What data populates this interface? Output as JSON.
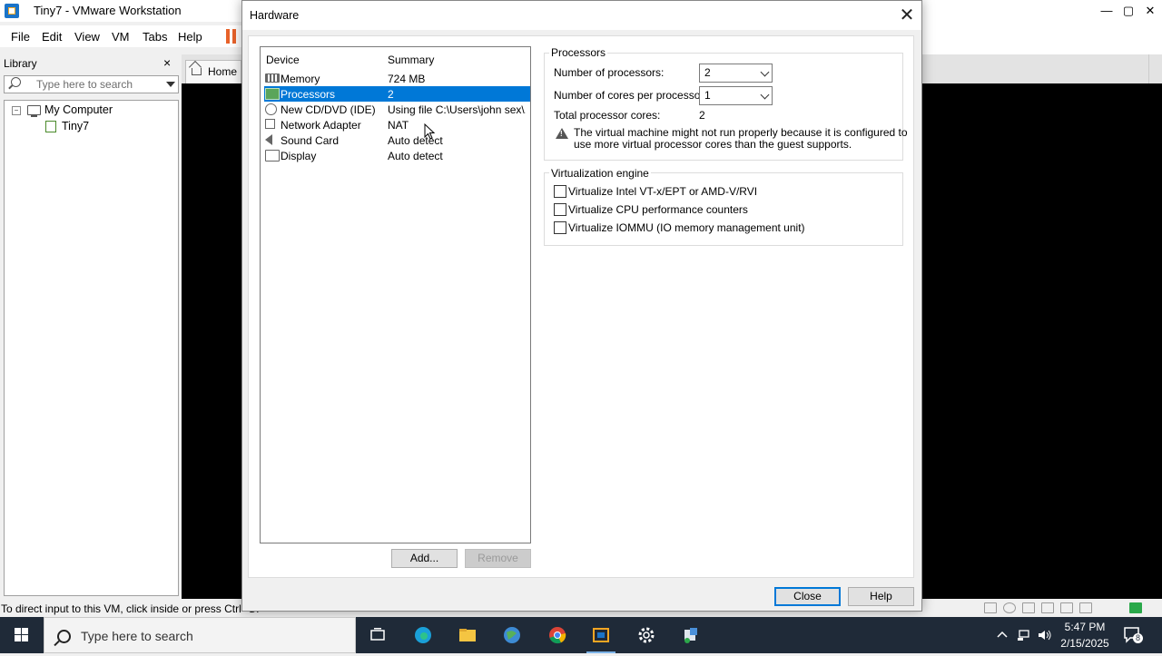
{
  "app": {
    "title": "Tiny7 - VMware Workstation",
    "menu": [
      "File",
      "Edit",
      "View",
      "VM",
      "Tabs",
      "Help"
    ]
  },
  "library": {
    "title": "Library",
    "close": "×",
    "search_placeholder": "Type here to search",
    "tree": {
      "root_label": "My Computer",
      "root_expander": "−",
      "child_label": "Tiny7"
    }
  },
  "tabs": {
    "home": "Home"
  },
  "status": {
    "text": "To direct input to this VM, click inside or press Ctrl+G."
  },
  "dialog": {
    "title": "Hardware",
    "close": "✕",
    "list_headers": {
      "device": "Device",
      "summary": "Summary"
    },
    "devices": [
      {
        "name": "Memory",
        "summary": "724 MB",
        "icon": "memory-icon"
      },
      {
        "name": "Processors",
        "summary": "2",
        "icon": "processor-icon",
        "selected": true
      },
      {
        "name": "New CD/DVD (IDE)",
        "summary": "Using file C:\\Users\\john sex\\...",
        "icon": "cd-dvd-icon"
      },
      {
        "name": "Network Adapter",
        "summary": "NAT",
        "icon": "network-adapter-icon"
      },
      {
        "name": "Sound Card",
        "summary": "Auto detect",
        "icon": "sound-card-icon"
      },
      {
        "name": "Display",
        "summary": "Auto detect",
        "icon": "display-icon"
      }
    ],
    "buttons": {
      "add": "Add...",
      "remove": "Remove",
      "close": "Close",
      "help": "Help"
    },
    "processors": {
      "group_title": "Processors",
      "num_processors_label": "Number of processors:",
      "num_processors_value": "2",
      "cores_label": "Number of cores per processor:",
      "cores_value": "1",
      "total_label": "Total processor cores:",
      "total_value": "2",
      "warning_line1": "The virtual machine might not run properly because it is configured to",
      "warning_line2": "use more virtual processor cores than the guest supports."
    },
    "virtualization": {
      "group_title": "Virtualization engine",
      "options": [
        {
          "label": "Virtualize Intel VT-x/EPT or AMD-V/RVI",
          "checked": false
        },
        {
          "label": "Virtualize CPU performance counters",
          "checked": false
        },
        {
          "label": "Virtualize IOMMU (IO memory management unit)",
          "checked": false
        }
      ]
    }
  },
  "taskbar": {
    "search_placeholder": "Type here to search",
    "time": "5:47 PM",
    "date": "2/15/2025",
    "notification_count": "8",
    "colors": {
      "bar": "#1f2a38",
      "accent": "#0078d7"
    }
  }
}
